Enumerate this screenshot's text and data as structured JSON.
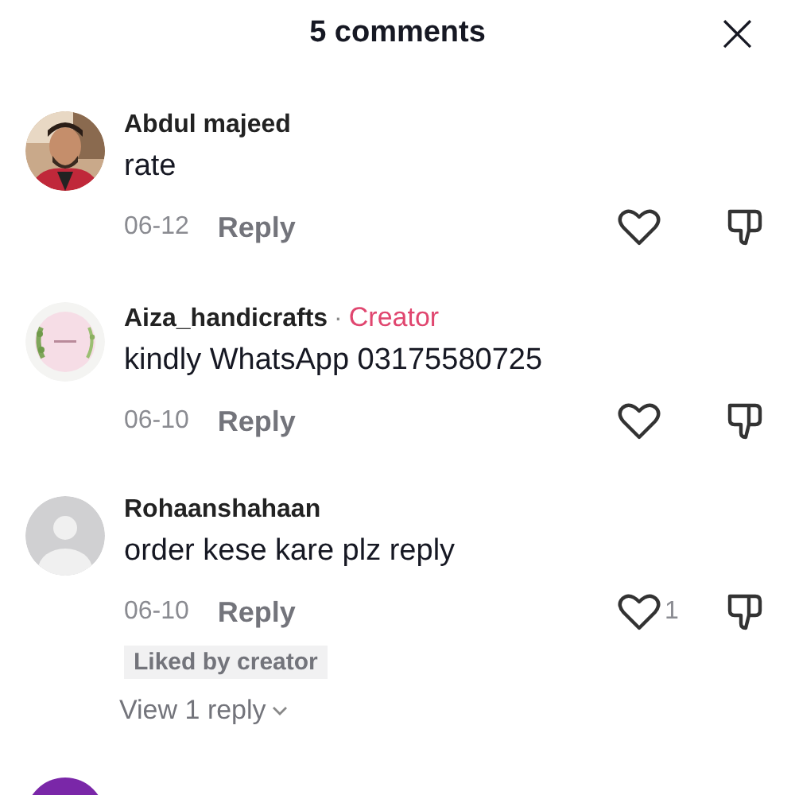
{
  "header": {
    "title": "5 comments",
    "close": "×"
  },
  "comments": [
    {
      "name": "Abdul majeed",
      "text": "rate",
      "date": "06-12",
      "reply": "Reply"
    },
    {
      "name": "Aiza_handicrafts",
      "separator": "·",
      "badge": "Creator",
      "text": "kindly WhatsApp 03175580725",
      "date": "06-10",
      "reply": "Reply"
    },
    {
      "avatar": {
        "kind": "default"
      },
      "name": "Rohaanshahaan",
      "text": "order kese kare plz reply",
      "date": "06-10",
      "reply": "Reply",
      "likes": "1",
      "liked_by_creator": "Liked by creator",
      "view_replies": "View 1 reply"
    },
    {
      "avatar": {
        "kind": "letter"
      }
    }
  ]
}
